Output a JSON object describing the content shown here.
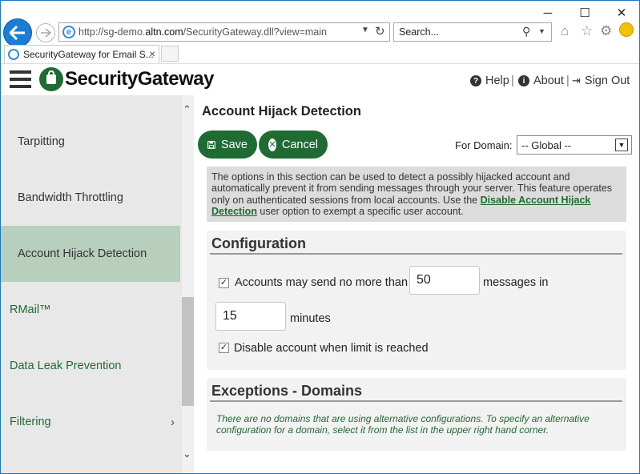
{
  "browser": {
    "url_prefix": "http://sg-demo.",
    "url_domain": "altn.com",
    "url_path": "/SecurityGateway.dll?view=main",
    "search_placeholder": "Search...",
    "tab_title": "SecurityGateway for Email S...",
    "tab_close": "×"
  },
  "window_controls": {
    "minimize": "─",
    "maximize": "☐",
    "close": "✕"
  },
  "header": {
    "logo_text": "SecurityGateway",
    "help": "Help",
    "about": "About",
    "signout": "Sign Out",
    "separator": "|"
  },
  "sidebar": {
    "items": [
      {
        "label": "Tarpitting"
      },
      {
        "label": "Bandwidth Throttling"
      },
      {
        "label": "Account Hijack Detection"
      },
      {
        "label": "RMail™"
      },
      {
        "label": "Data Leak Prevention"
      },
      {
        "label": "Filtering"
      }
    ]
  },
  "page": {
    "title": "Account Hijack Detection",
    "save_label": "Save",
    "cancel_label": "Cancel",
    "domain_label": "For Domain:",
    "domain_value": "-- Global --",
    "info_pre": "The options in this section can be used to detect a possibly hijacked account and automatically prevent it from sending messages through your server. This feature operates only on authenticated sessions from local accounts. Use the ",
    "info_link": "Disable Account Hijack Detection",
    "info_post": " user option to exempt a specific user account."
  },
  "config": {
    "title": "Configuration",
    "limit_label": "Accounts may send no more than",
    "messages_value": "50",
    "messages_in": "messages in",
    "minutes_value": "15",
    "minutes_label": "minutes",
    "disable_label": "Disable account when limit is reached"
  },
  "exceptions": {
    "title": "Exceptions - Domains",
    "text": "There are no domains that are using alternative configurations. To specify an alternative configuration for a domain, select it from the list in the upper right hand corner."
  },
  "colors": {
    "brand_green": "#1f6b34",
    "selected_item": "#b9cfbe",
    "ie_blue": "#1a7fd4"
  }
}
